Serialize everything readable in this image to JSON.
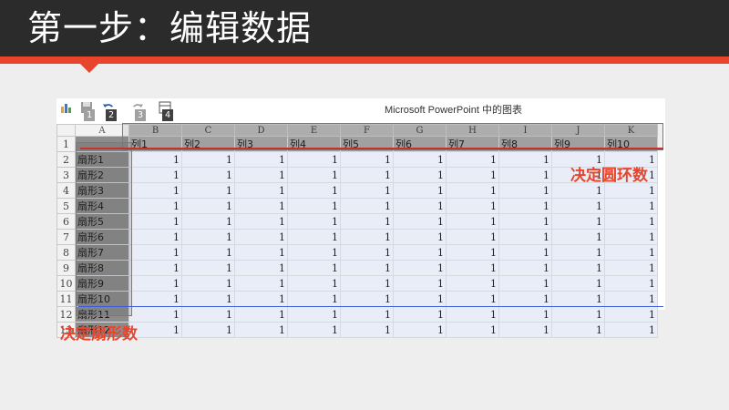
{
  "slide_title": "第一步：编辑数据",
  "window_title": "Microsoft PowerPoint 中的图表",
  "toolbar": {
    "key_1": "1",
    "key_2": "2",
    "key_3": "3",
    "key_4": "4"
  },
  "column_letters": [
    "A",
    "B",
    "C",
    "D",
    "E",
    "F",
    "G",
    "H",
    "I",
    "J",
    "K"
  ],
  "header_row": [
    "列1",
    "列2",
    "列3",
    "列4",
    "列5",
    "列6",
    "列7",
    "列8",
    "列9",
    "列10"
  ],
  "row_numbers": [
    "1",
    "2",
    "3",
    "4",
    "5",
    "6",
    "7",
    "8",
    "9",
    "10",
    "11",
    "12",
    "13"
  ],
  "row_labels": [
    "扇形1",
    "扇形2",
    "扇形3",
    "扇形4",
    "扇形5",
    "扇形6",
    "扇形7",
    "扇形8",
    "扇形9",
    "扇形10",
    "扇形11",
    "扇形12"
  ],
  "cell_value": "1",
  "callout_rings": "决定圆环数",
  "callout_sectors": "决定扇形数",
  "colors": {
    "title_bar": "#2b2b2b",
    "accent": "#e8452c",
    "selection_gray": "#8c8c8c",
    "cell_blue": "#e9edf7"
  }
}
